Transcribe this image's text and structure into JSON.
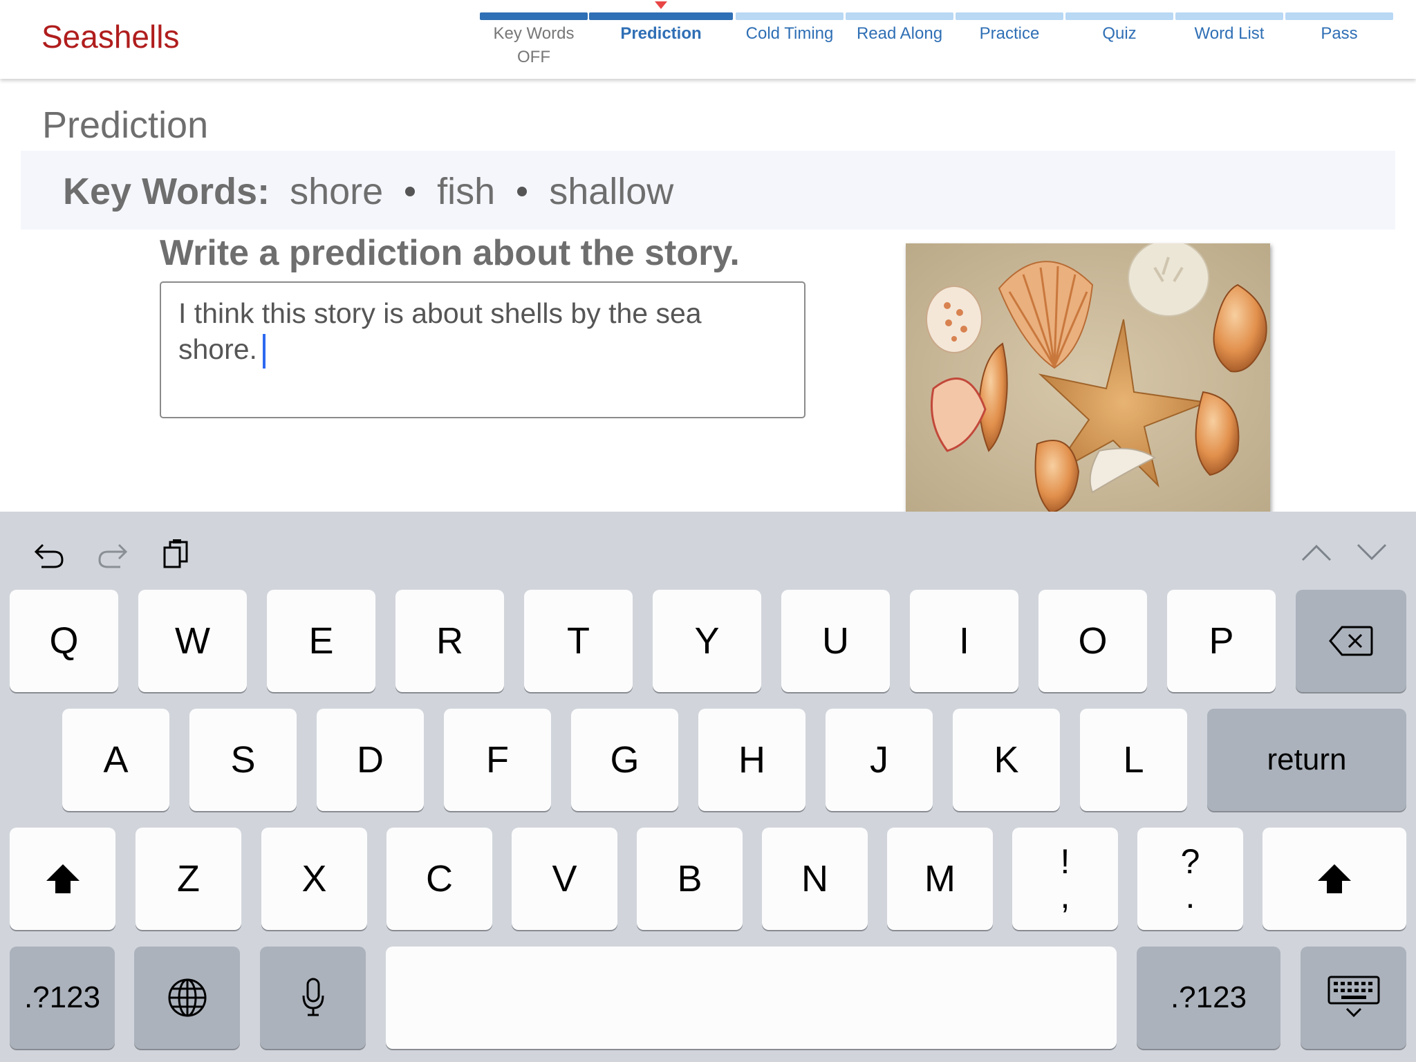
{
  "app": {
    "title": "Seashells"
  },
  "tabs": [
    {
      "label": "Key Words",
      "sublabel": "OFF",
      "state": "done"
    },
    {
      "label": "Prediction",
      "sublabel": "",
      "state": "active"
    },
    {
      "label": "Cold Timing",
      "sublabel": "",
      "state": "todo"
    },
    {
      "label": "Read Along",
      "sublabel": "",
      "state": "todo"
    },
    {
      "label": "Practice",
      "sublabel": "",
      "state": "todo"
    },
    {
      "label": "Quiz",
      "sublabel": "",
      "state": "todo"
    },
    {
      "label": "Word List",
      "sublabel": "",
      "state": "todo"
    },
    {
      "label": "Pass",
      "sublabel": "",
      "state": "todo"
    }
  ],
  "page": {
    "title": "Prediction",
    "keywords_label": "Key Words:",
    "keywords": [
      "shore",
      "fish",
      "shallow"
    ],
    "instruction": "Write a prediction about the story.",
    "answer_text": "I think this story is about shells by the sea shore."
  },
  "keyboard": {
    "toolbar": [
      "undo-icon",
      "redo-icon",
      "paste-icon",
      "chevron-up-icon",
      "chevron-down-icon"
    ],
    "row1": [
      "Q",
      "W",
      "E",
      "R",
      "T",
      "Y",
      "U",
      "I",
      "O",
      "P"
    ],
    "row2": [
      "A",
      "S",
      "D",
      "F",
      "G",
      "H",
      "J",
      "K",
      "L"
    ],
    "row3": [
      "Z",
      "X",
      "C",
      "V",
      "B",
      "N",
      "M"
    ],
    "punct": [
      {
        "top": "!",
        "bottom": ","
      },
      {
        "top": "?",
        "bottom": "."
      }
    ],
    "return_label": "return",
    "numbers_label": ".?123"
  },
  "colors": {
    "brand": "#b01d1d",
    "tab_done": "#2f6fb5",
    "tab_todo": "#b8d8f4",
    "caret": "#2d68f0"
  }
}
